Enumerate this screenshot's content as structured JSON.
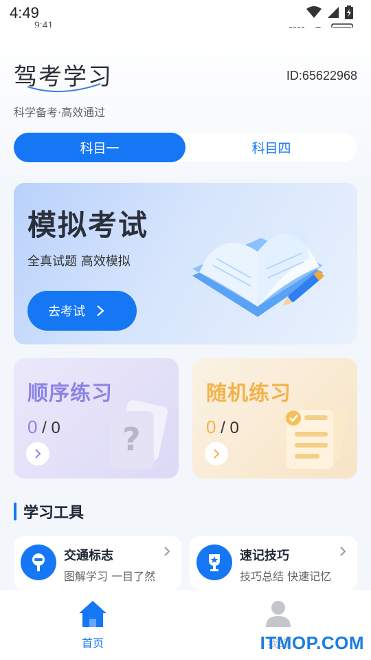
{
  "status_bar": {
    "time": "4:49",
    "ghost_time": "9:41"
  },
  "header": {
    "app_title": "驾考学习",
    "user_id": "ID:65622968",
    "subtitle": "科学备考·高效通过"
  },
  "tabs": [
    {
      "label": "科目一",
      "active": true
    },
    {
      "label": "科目四",
      "active": false
    }
  ],
  "exam_card": {
    "title": "模拟考试",
    "subtitle": "全真试题 高效模拟",
    "button_label": "去考试"
  },
  "practice": {
    "sequential": {
      "title": "顺序练习",
      "current": "0",
      "separator": "/",
      "total": "0"
    },
    "random": {
      "title": "随机练习",
      "current": "0",
      "separator": "/",
      "total": "0"
    }
  },
  "tools_section": {
    "title": "学习工具"
  },
  "tools": [
    {
      "title": "交通标志",
      "desc": "图解学习 一目了然",
      "icon": "traffic-sign-icon"
    },
    {
      "title": "速记技巧",
      "desc": "技巧总结 快速记忆",
      "icon": "trophy-icon"
    }
  ],
  "bottom_nav": [
    {
      "label": "首页",
      "icon": "home-icon",
      "active": true
    },
    {
      "label": "我的",
      "icon": "user-icon",
      "active": false
    }
  ],
  "watermark": "ITMOP.COM",
  "colors": {
    "accent": "#1677f5",
    "sequential": "#8c83e6",
    "random": "#f3b24a"
  }
}
